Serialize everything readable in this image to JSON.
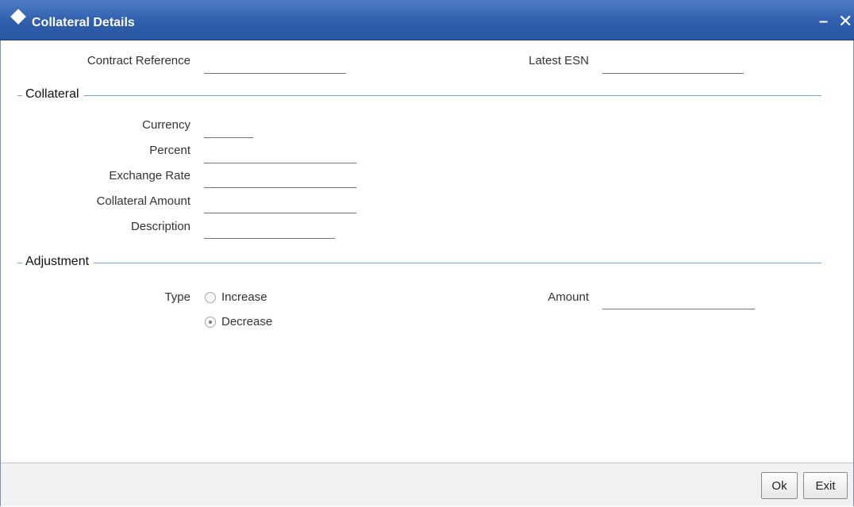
{
  "window": {
    "title": "Collateral Details",
    "minimize_glyph": "–",
    "close_glyph": "✕"
  },
  "header": {
    "contract_reference": {
      "label": "Contract Reference",
      "value": ""
    },
    "latest_esn": {
      "label": "Latest ESN",
      "value": ""
    }
  },
  "collateral": {
    "legend": "Collateral",
    "currency": {
      "label": "Currency",
      "value": ""
    },
    "percent": {
      "label": "Percent",
      "value": ""
    },
    "exchange_rate": {
      "label": "Exchange Rate",
      "value": ""
    },
    "collateral_amount": {
      "label": "Collateral Amount",
      "value": ""
    },
    "description": {
      "label": "Description",
      "value": ""
    }
  },
  "adjustment": {
    "legend": "Adjustment",
    "type": {
      "label": "Type",
      "options": [
        {
          "label": "Increase",
          "selected": false
        },
        {
          "label": "Decrease",
          "selected": true
        }
      ]
    },
    "amount": {
      "label": "Amount",
      "value": ""
    }
  },
  "footer": {
    "ok_label": "Ok",
    "exit_label": "Exit"
  },
  "icons": {
    "title": "diamond-icon"
  }
}
